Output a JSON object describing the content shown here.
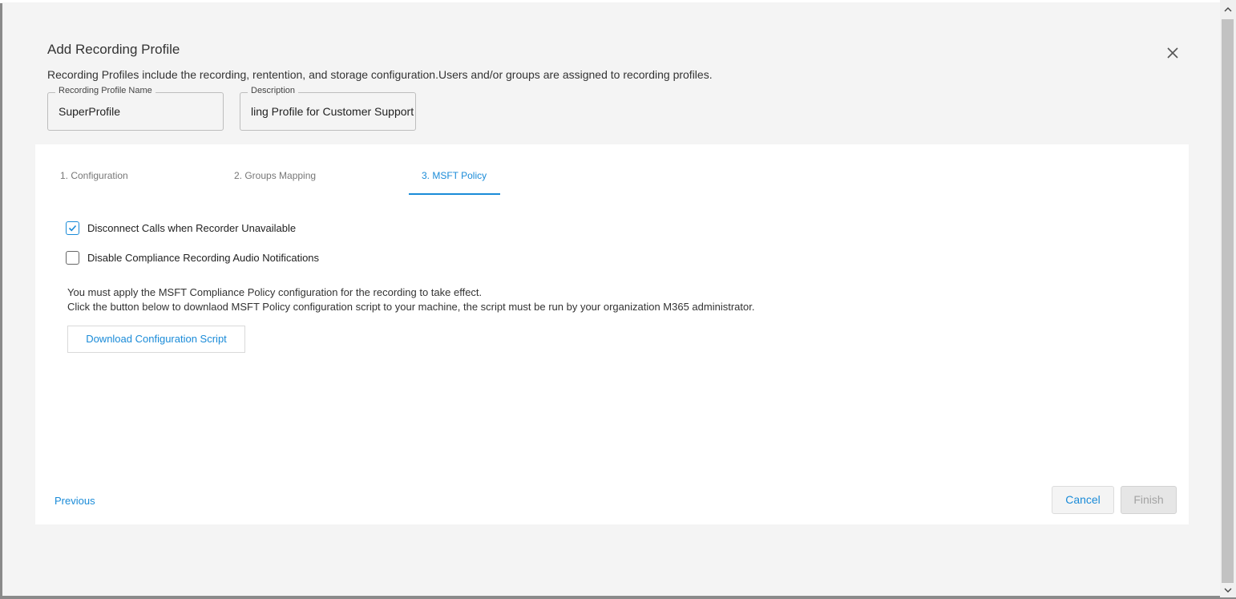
{
  "dialog": {
    "title": "Add Recording Profile",
    "subtitle": "Recording Profiles include the recording, rentention, and storage configuration.Users and/or groups are assigned to recording profiles.",
    "close_icon": "close-icon"
  },
  "fields": {
    "profile_name": {
      "label": "Recording Profile Name",
      "value": "SuperProfile"
    },
    "description": {
      "label": "Description",
      "value": "ling Profile for Customer Support"
    }
  },
  "tabs": [
    {
      "label": "1. Configuration",
      "active": false
    },
    {
      "label": "2. Groups Mapping",
      "active": false
    },
    {
      "label": "3. MSFT Policy",
      "active": true
    }
  ],
  "options": [
    {
      "label": "Disconnect Calls when Recorder Unavailable",
      "checked": true
    },
    {
      "label": "Disable Compliance Recording Audio Notifications",
      "checked": false
    }
  ],
  "info": {
    "line1": "You must apply the MSFT Compliance Policy configuration for the recording to take effect.",
    "line2": "Click the button below to downlaod MSFT Policy configuration script to your machine, the script must be run by your organization M365 administrator."
  },
  "buttons": {
    "download": "Download Configuration Script",
    "previous": "Previous",
    "cancel": "Cancel",
    "finish": "Finish"
  },
  "colors": {
    "accent": "#1a8bd8",
    "dialog_bg": "#f4f4f4",
    "panel_bg": "#ffffff"
  }
}
